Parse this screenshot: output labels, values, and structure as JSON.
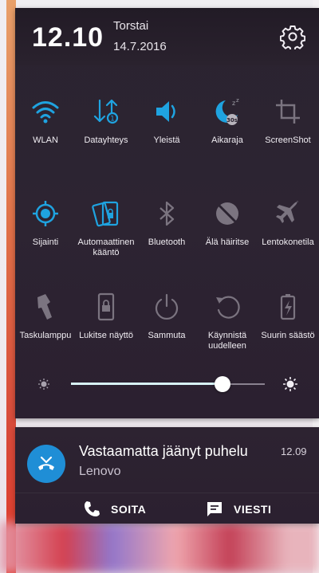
{
  "status": {
    "time": "12.10",
    "day": "Torstai",
    "date": "14.7.2016"
  },
  "colors": {
    "accent": "#1fa3e0",
    "tile_off": "#7b7480",
    "panel_bg": "#2a2330",
    "notif_avatar": "#1f8ed6"
  },
  "tiles": [
    {
      "label": "WLAN",
      "icon": "wifi-icon",
      "on": true
    },
    {
      "label": "Datayhteys",
      "icon": "data-transfer-icon",
      "on": true
    },
    {
      "label": "Yleistä",
      "icon": "volume-icon",
      "on": true
    },
    {
      "label": "Aikaraja",
      "icon": "sleep-timer-icon",
      "on": true
    },
    {
      "label": "ScreenShot",
      "icon": "crop-icon",
      "on": false
    },
    {
      "label": "Sijainti",
      "icon": "location-icon",
      "on": true
    },
    {
      "label": "Automaattinen kääntö",
      "icon": "auto-rotate-icon",
      "on": true
    },
    {
      "label": "Bluetooth",
      "icon": "bluetooth-icon",
      "on": false
    },
    {
      "label": "Älä häiritse",
      "icon": "do-not-disturb-icon",
      "on": false
    },
    {
      "label": "Lentokonetila",
      "icon": "airplane-icon",
      "on": false
    },
    {
      "label": "Taskulamppu",
      "icon": "flashlight-icon",
      "on": false
    },
    {
      "label": "Lukitse näyttö",
      "icon": "lock-screen-icon",
      "on": false
    },
    {
      "label": "Sammuta",
      "icon": "power-icon",
      "on": false
    },
    {
      "label": "Käynnistä uudelleen",
      "icon": "restart-icon",
      "on": false
    },
    {
      "label": "Suurin säästö",
      "icon": "battery-saver-icon",
      "on": false
    }
  ],
  "brightness": {
    "level": 0.78
  },
  "notification": {
    "title": "Vastaamatta jäänyt puhelu",
    "time": "12.09",
    "subtitle": "Lenovo",
    "actions": [
      {
        "label": "SOITA",
        "icon": "phone-icon"
      },
      {
        "label": "VIESTI",
        "icon": "message-icon"
      }
    ]
  }
}
